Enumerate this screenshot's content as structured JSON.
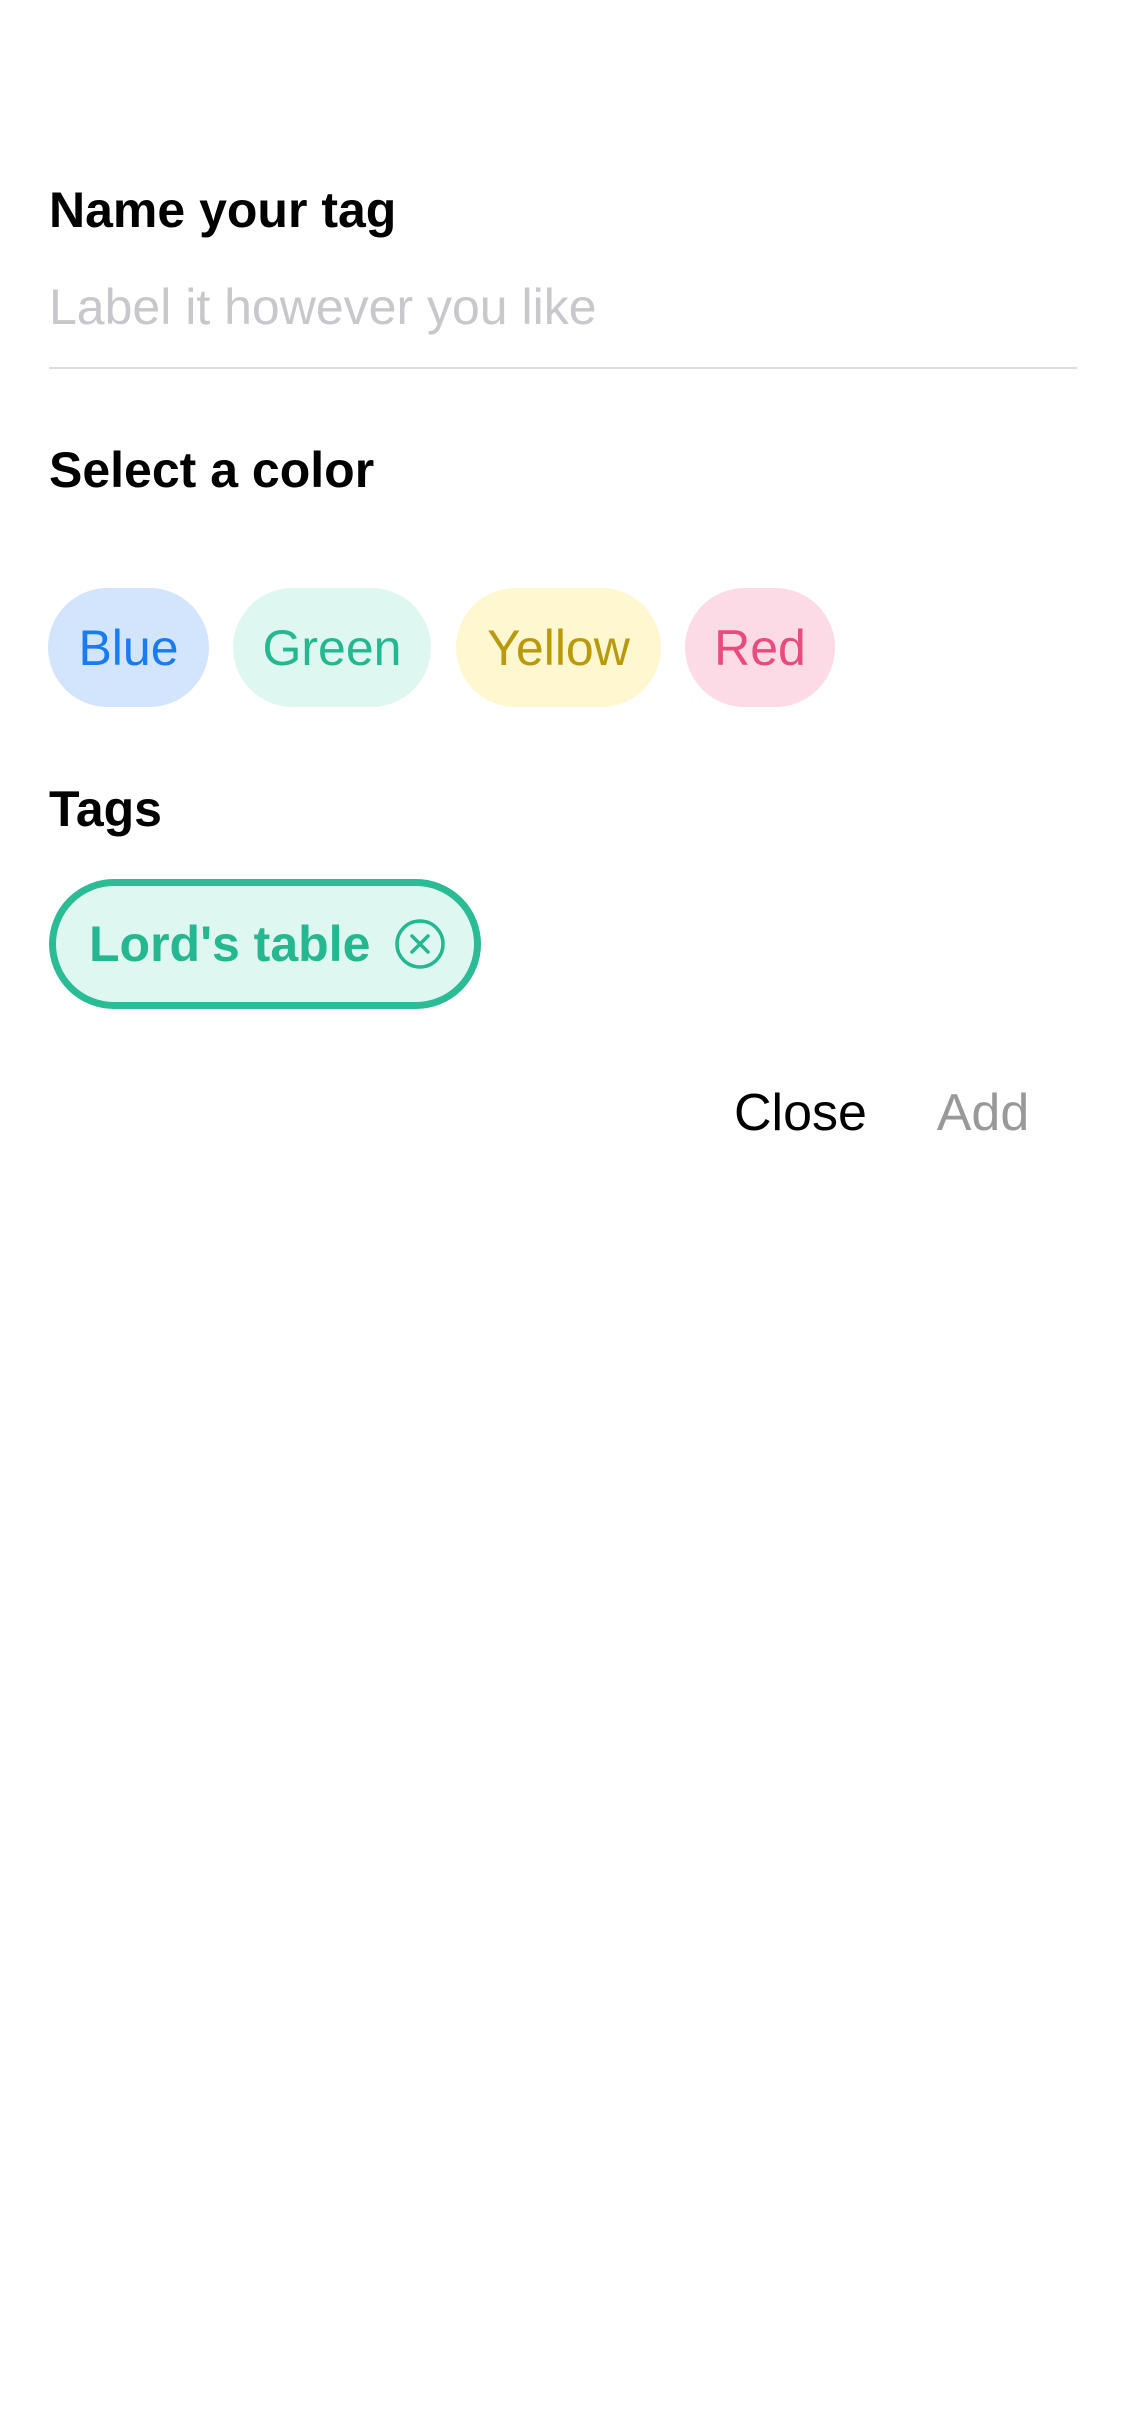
{
  "name_section": {
    "title": "Name your tag",
    "input_value": "",
    "input_placeholder": "Label it however you like"
  },
  "color_section": {
    "title": "Select a color",
    "options": [
      {
        "label": "Blue",
        "text_color": "#1a7cf0",
        "bg_color": "#d3e5fd"
      },
      {
        "label": "Green",
        "text_color": "#25b890",
        "bg_color": "#def8f1"
      },
      {
        "label": "Yellow",
        "text_color": "#b89a0c",
        "bg_color": "#fef7cf"
      },
      {
        "label": "Red",
        "text_color": "#e84c7c",
        "bg_color": "#fcdbe6"
      }
    ]
  },
  "tags_section": {
    "title": "Tags",
    "items": [
      {
        "label": "Lord's table",
        "text_color": "#25b890",
        "bg_color": "#def8f1",
        "border_color": "#2bbb95",
        "remove_icon": "close-circle-icon"
      }
    ]
  },
  "actions": {
    "close_label": "Close",
    "add_label": "Add",
    "add_color": "#999999",
    "close_color": "#000000"
  }
}
